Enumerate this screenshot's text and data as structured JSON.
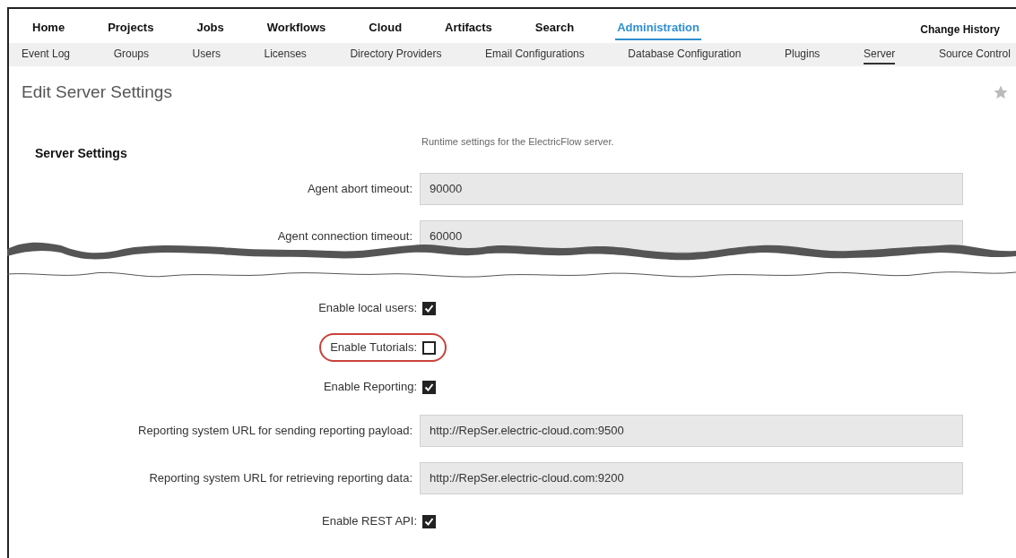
{
  "nav": {
    "items": [
      {
        "label": "Home",
        "selected": false
      },
      {
        "label": "Projects",
        "selected": false
      },
      {
        "label": "Jobs",
        "selected": false
      },
      {
        "label": "Workflows",
        "selected": false
      },
      {
        "label": "Cloud",
        "selected": false
      },
      {
        "label": "Artifacts",
        "selected": false
      },
      {
        "label": "Search",
        "selected": false
      },
      {
        "label": "Administration",
        "selected": true
      }
    ],
    "right_link": "Change History"
  },
  "subnav": [
    {
      "label": "Event Log",
      "selected": false
    },
    {
      "label": "Groups",
      "selected": false
    },
    {
      "label": "Users",
      "selected": false
    },
    {
      "label": "Licenses",
      "selected": false
    },
    {
      "label": "Directory Providers",
      "selected": false
    },
    {
      "label": "Email Configurations",
      "selected": false
    },
    {
      "label": "Database Configuration",
      "selected": false
    },
    {
      "label": "Plugins",
      "selected": false
    },
    {
      "label": "Server",
      "selected": true
    },
    {
      "label": "Source Control",
      "selected": false
    }
  ],
  "page_title": "Edit Server Settings",
  "section": {
    "heading": "Server Settings",
    "description": "Runtime settings for the ElectricFlow server."
  },
  "fields_before_break": [
    {
      "kind": "text",
      "label": "Agent abort timeout:",
      "value": "90000"
    },
    {
      "kind": "text",
      "label": "Agent connection timeout:",
      "value": "60000"
    }
  ],
  "fields_after_break": [
    {
      "kind": "checkbox",
      "label": "Enable local users:",
      "checked": true,
      "highlighted": false
    },
    {
      "kind": "checkbox",
      "label": "Enable Tutorials:",
      "checked": false,
      "highlighted": true
    },
    {
      "kind": "checkbox",
      "label": "Enable Reporting:",
      "checked": true,
      "highlighted": false
    },
    {
      "kind": "text",
      "label": "Reporting system URL for sending reporting payload:",
      "value": "http://RepSer.electric-cloud.com:9500"
    },
    {
      "kind": "text",
      "label": "Reporting system URL for retrieving reporting data:",
      "value": "http://RepSer.electric-cloud.com:9200"
    },
    {
      "kind": "checkbox",
      "label": "Enable REST API:",
      "checked": true,
      "highlighted": false
    }
  ]
}
